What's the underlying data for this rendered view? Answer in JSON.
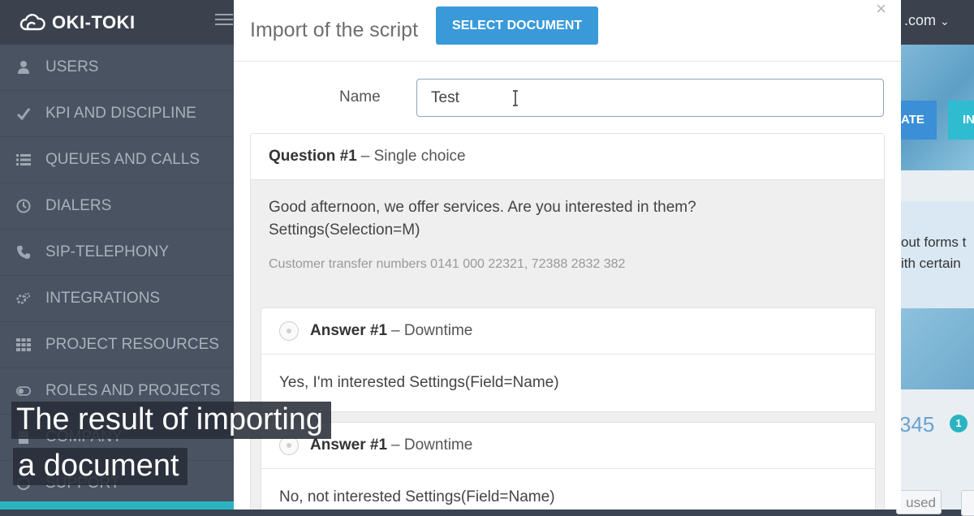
{
  "app": {
    "brand": "OKI-TOKI",
    "account_suffix": ".com"
  },
  "sidebar": {
    "items": [
      {
        "label": "USERS",
        "icon": "user-icon"
      },
      {
        "label": "KPI AND DISCIPLINE",
        "icon": "check-icon"
      },
      {
        "label": "QUEUES AND CALLS",
        "icon": "list-icon"
      },
      {
        "label": "DIALERS",
        "icon": "clock-icon"
      },
      {
        "label": "SIP-TELEPHONY",
        "icon": "phone-icon"
      },
      {
        "label": "INTEGRATIONS",
        "icon": "gears-icon"
      },
      {
        "label": "PROJECT RESOURCES",
        "icon": "grid-icon"
      },
      {
        "label": "ROLES AND PROJECTS",
        "icon": "toggle-icon"
      },
      {
        "label": "COMPANY",
        "icon": "building-icon"
      },
      {
        "label": "SUPPORT",
        "icon": "support-icon"
      }
    ]
  },
  "background": {
    "button1": "ATE",
    "button2": "IN",
    "card_line1": "out forms t",
    "card_line2": "ith certain",
    "stat": "345",
    "badge": "1",
    "chip": "used"
  },
  "modal": {
    "title": "Import of the script",
    "select_button": "SELECT DOCUMENT",
    "close": "×",
    "name_label": "Name",
    "name_value": "Test",
    "question": {
      "title": "Question #1",
      "type": "– Single choice",
      "text": "Good afternoon, we offer services. Are you interested in them? Settings(Selection=M)",
      "note": "Customer transfer numbers 0141 000 22321, 72388 2832 382"
    },
    "answers": [
      {
        "title": "Answer #1",
        "type": "– Downtime",
        "text": "Yes, I'm interested Settings(Field=Name)"
      },
      {
        "title": "Answer #1",
        "type": "– Downtime",
        "text": "No, not interested Settings(Field=Name)"
      }
    ]
  },
  "caption": {
    "line1": "The result of importing",
    "line2": "a document"
  }
}
